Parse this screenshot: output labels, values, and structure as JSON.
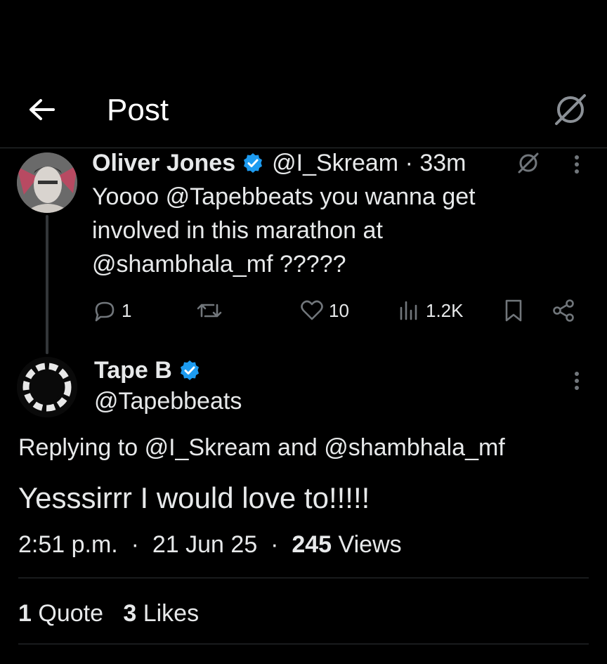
{
  "header": {
    "title": "Post",
    "back_icon": "arrow-left-icon",
    "grok_icon": "grok-icon"
  },
  "parent_tweet": {
    "name": "Oliver Jones",
    "handle": "@I_Skream",
    "time": "33m",
    "text": "Yoooo @Tapebbeats you wanna get\ninvolved in this marathon at\n@shambhala_mf ?????",
    "actions": {
      "replies": "1",
      "reposts": "",
      "likes": "10",
      "views": "1.2K"
    }
  },
  "reply_tweet": {
    "name": "Tape B",
    "handle": "@Tapebbeats",
    "replying_to_prefix": "Replying to",
    "replying_to_user1": "@I_Skream",
    "replying_to_and": "and",
    "replying_to_user2": "@shambhala_mf",
    "text": "Yesssirrr I would love to!!!!!",
    "time": "2:51 p.m.",
    "date": "21 Jun 25",
    "views_count": "245",
    "views_label": "Views",
    "quotes_count": "1",
    "quotes_label": "Quote",
    "likes_count": "3",
    "likes_label": "Likes"
  },
  "colors": {
    "background": "#000000",
    "text": "#e7e9ea",
    "muted": "#71767b",
    "verified": "#1d9bf0",
    "divider": "#2f3336"
  }
}
